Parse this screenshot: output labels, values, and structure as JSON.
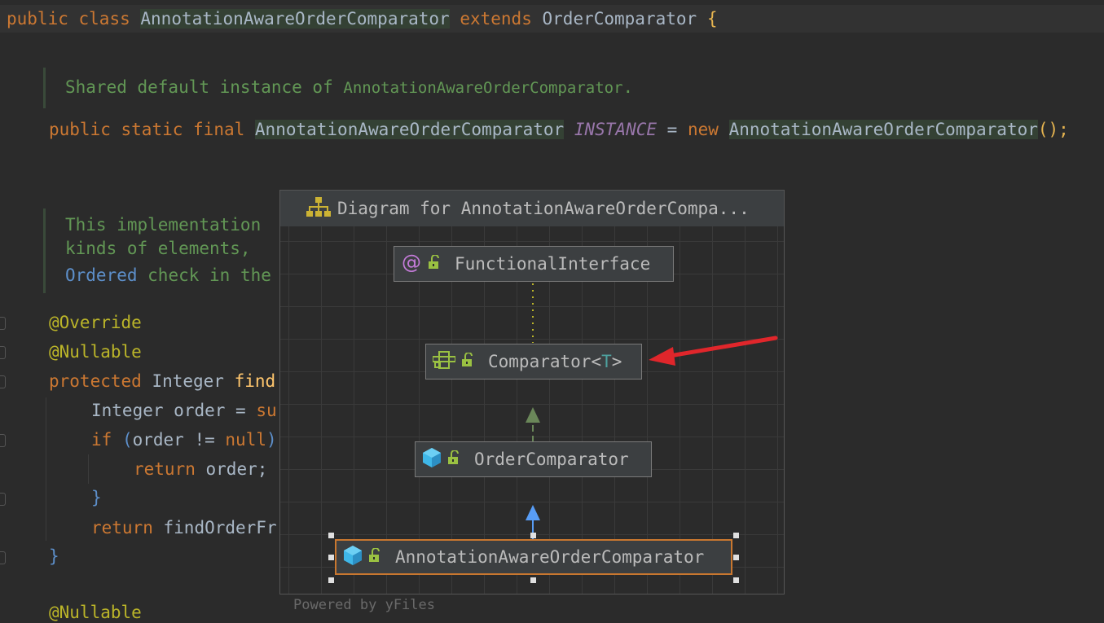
{
  "editor": {
    "line1": {
      "kw1": "public",
      "kw2": "class",
      "name": "AnnotationAwareOrderComparator",
      "kw3": "extends",
      "parent": "OrderComparator",
      "brace": "{"
    },
    "doc1": {
      "text": "Shared default instance of ",
      "ref": "AnnotationAwareOrderComparator",
      "tail": "."
    },
    "line2": {
      "kw1": "public",
      "kw2": "static",
      "kw3": "final",
      "type": "AnnotationAwareOrderComparator",
      "field": "INSTANCE",
      "eq": "=",
      "kw4": "new",
      "ctor": "AnnotationAwareOrderComparator",
      "end": "();"
    },
    "doc2": {
      "l1": "This implementation",
      "l2": "kinds of elements,",
      "l3_link": "Ordered",
      "l3_text": " check in the"
    },
    "code": {
      "ann1": "@Override",
      "ann2": "@Nullable",
      "sig_kw": "protected",
      "sig_type": "Integer",
      "sig_method": "find",
      "l_order_type": "Integer",
      "l_order_rest": "order = ",
      "l_order_kw": "su",
      "l_if_kw": "if",
      "l_if_paren": "(",
      "l_if_rest": "order != ",
      "l_if_null": "null",
      "l_if_close": ")",
      "l_ret_kw": "return",
      "l_ret_rest": "order;",
      "l_close": "}",
      "l_ret2_kw": "return",
      "l_ret2_rest": "findOrderFr",
      "l_close2": "}",
      "l_next": "@Nullable"
    }
  },
  "popup": {
    "title": "Diagram for AnnotationAwareOrderCompa...",
    "nodes": {
      "functional": "FunctionalInterface",
      "comparator": "Comparator",
      "comparator_lt": "<",
      "comparator_t": "T",
      "comparator_gt": ">",
      "order": "OrderComparator",
      "annotation": "AnnotationAwareOrderComparator"
    },
    "powered": "Powered by yFiles"
  },
  "colors": {
    "arrow": "#e0262b",
    "selected_border": "#c9772f",
    "impl_arrow": "#6a8759",
    "extends_arrow": "#589df6"
  }
}
